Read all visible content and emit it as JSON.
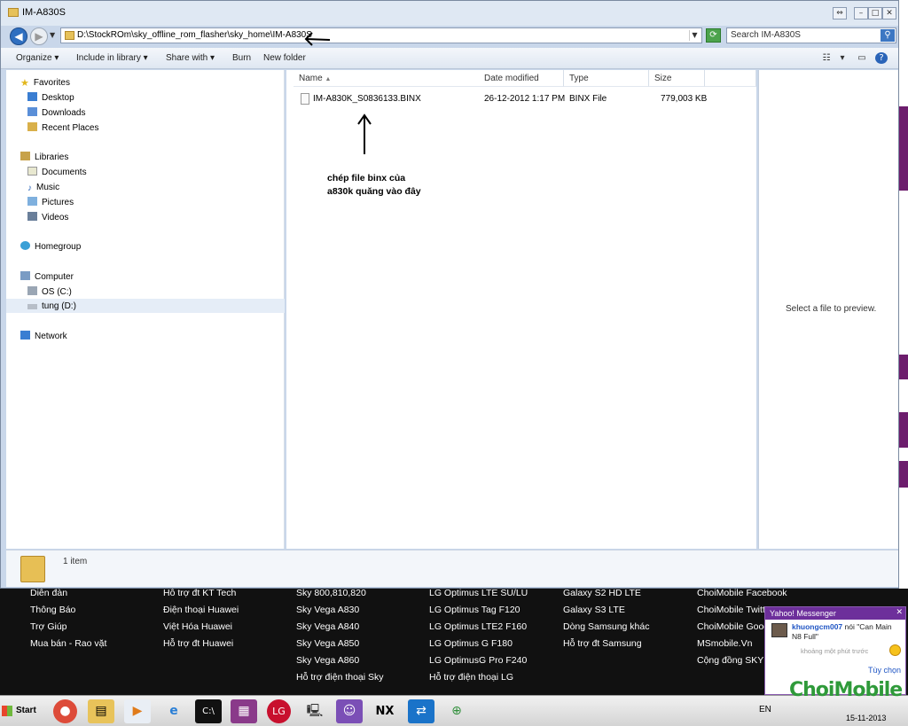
{
  "window": {
    "title": "IM-A830S",
    "controls": {
      "resize": "⇔",
      "minimize": "–",
      "maximize": "□",
      "close": "✕"
    }
  },
  "address": {
    "path": "D:\\StockROm\\sky_offline_rom_flasher\\sky_home\\IM-A830S",
    "search_placeholder": "Search IM-A830S"
  },
  "toolbar": {
    "organize": "Organize",
    "include_in_library": "Include in library",
    "share_with": "Share with",
    "burn": "Burn",
    "new_folder": "New folder"
  },
  "nav": {
    "favorites": "Favorites",
    "desktop": "Desktop",
    "downloads": "Downloads",
    "recent_places": "Recent Places",
    "libraries": "Libraries",
    "documents": "Documents",
    "music": "Music",
    "pictures": "Pictures",
    "videos": "Videos",
    "homegroup": "Homegroup",
    "computer": "Computer",
    "os_c": "OS (C:)",
    "tung_d": "tung (D:)",
    "network": "Network"
  },
  "columns": {
    "name": "Name",
    "date_modified": "Date modified",
    "type": "Type",
    "size": "Size"
  },
  "files": [
    {
      "name": "IM-A830K_S0836133.BINX",
      "date": "26-12-2012 1:17 PM",
      "type": "BINX File",
      "size": "779,003 KB"
    }
  ],
  "annotation": {
    "line1": "chép file binx của",
    "line2": "a830k quăng vào đây"
  },
  "preview": {
    "text": "Select a file to preview."
  },
  "details": {
    "count": "1 item"
  },
  "footer": {
    "col1": [
      "Diễn đàn",
      "Thông Báo",
      "Trợ Giúp",
      "Mua bán - Rao vặt"
    ],
    "col2": [
      "Hỗ trợ đt KT Tech",
      "Điện thoại Huawei",
      "Việt Hóa Huawei",
      "Hỗ trợ đt Huawei"
    ],
    "col3": [
      "Sky 800,810,820",
      "Sky Vega A830",
      "Sky Vega A840",
      "Sky Vega A850",
      "Sky Vega A860",
      "Hỗ trợ điện thoại Sky"
    ],
    "col4": [
      "LG Optimus LTE SU/LU",
      "LG Optimus Tag F120",
      "LG Optimus LTE2 F160",
      "LG Optimus G F180",
      "LG OptimusG Pro F240",
      "Hỗ trợ điện thoại LG"
    ],
    "col5": [
      "Galaxy S2 HD LTE",
      "Galaxy S3 LTE",
      "Dòng Samsung khác",
      "Hỗ trợ đt Samsung"
    ],
    "col6": [
      "ChoiMobile Facebook",
      "ChoiMobile Twitt",
      "ChoiMobile Goog",
      "MSmobile.Vn",
      "Cộng đồng SKY V"
    ]
  },
  "messenger": {
    "title": "Yahoo! Messenger",
    "user": "khuongcm007",
    "message": " nói \"Can Main N8 Full\"",
    "time": "khoảng một phút trước",
    "reply": "Tùy chọn"
  },
  "taskbar": {
    "start": "Start",
    "language": "EN",
    "date": "15-11-2013",
    "apps": [
      "chrome-icon",
      "explorer-icon",
      "media-player-icon",
      "ie-icon",
      "cmd-icon",
      "winrar-icon",
      "lg-icon",
      "device-manager-icon",
      "messenger-icon",
      "nx-icon",
      "teamviewer-icon",
      "idm-icon"
    ]
  },
  "watermark": "ChoiMobile"
}
